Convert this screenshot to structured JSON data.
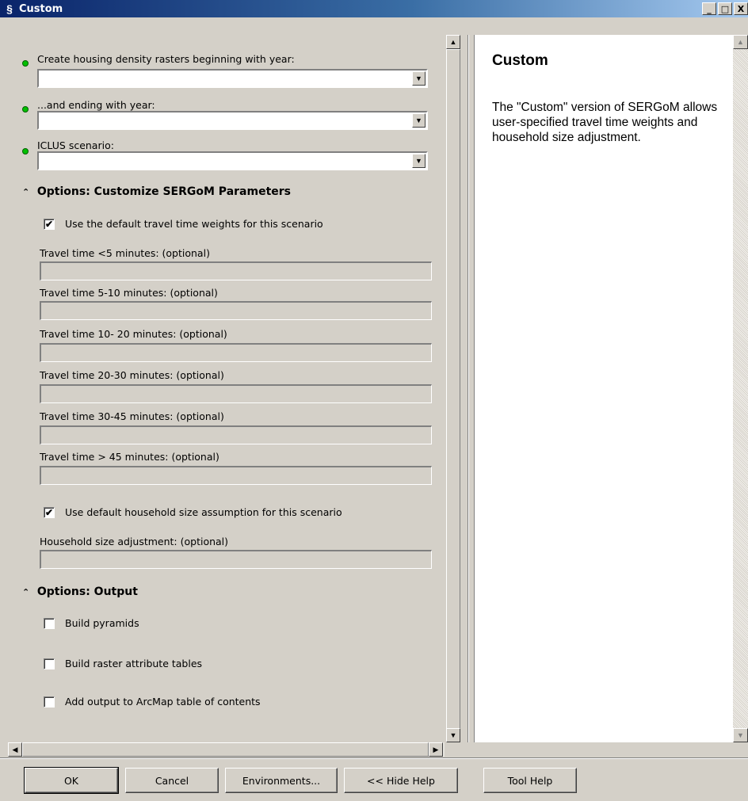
{
  "window": {
    "title": "Custom",
    "controls": {
      "minimize": "_",
      "maximize": "□",
      "close": "X"
    }
  },
  "params": {
    "start_year": {
      "label": "Create housing density rasters beginning with year:",
      "value": ""
    },
    "end_year": {
      "label": "...and ending with year:",
      "value": ""
    },
    "scenario": {
      "label": "ICLUS scenario:",
      "value": ""
    }
  },
  "sergom": {
    "header": "Options: Customize SERGoM Parameters",
    "default_weights": {
      "label": "Use the default travel time weights for this scenario",
      "checked": true
    },
    "travel_fields": [
      {
        "label": "Travel time <5 minutes: (optional)",
        "value": ""
      },
      {
        "label": "Travel time 5-10 minutes: (optional)",
        "value": ""
      },
      {
        "label": "Travel time 10- 20 minutes: (optional)",
        "value": ""
      },
      {
        "label": "Travel time 20-30 minutes: (optional)",
        "value": ""
      },
      {
        "label": "Travel time 30-45 minutes: (optional)",
        "value": ""
      },
      {
        "label": "Travel time > 45 minutes: (optional)",
        "value": ""
      }
    ],
    "default_household": {
      "label": "Use default household size assumption for this scenario",
      "checked": true
    },
    "household_field": {
      "label": "Household size adjustment: (optional)",
      "value": ""
    }
  },
  "output": {
    "header": "Options: Output",
    "build_pyramids": {
      "label": "Build pyramids",
      "checked": false
    },
    "build_attr_tables": {
      "label": "Build raster attribute tables",
      "checked": false
    },
    "add_to_toc": {
      "label": "Add output to ArcMap table of contents",
      "checked": false
    }
  },
  "help": {
    "title": "Custom",
    "body": "The \"Custom\" version of SERGoM allows user-specified travel time weights and household size adjustment."
  },
  "buttons": {
    "ok": "OK",
    "cancel": "Cancel",
    "environments": "Environments...",
    "hide_help": "<< Hide Help",
    "tool_help": "Tool Help"
  },
  "icons": {
    "check": "✔",
    "chevron_up": "⌃",
    "arrow_down": "▼",
    "arrow_up": "▲",
    "arrow_left": "◀",
    "arrow_right": "▶",
    "app": "§"
  }
}
